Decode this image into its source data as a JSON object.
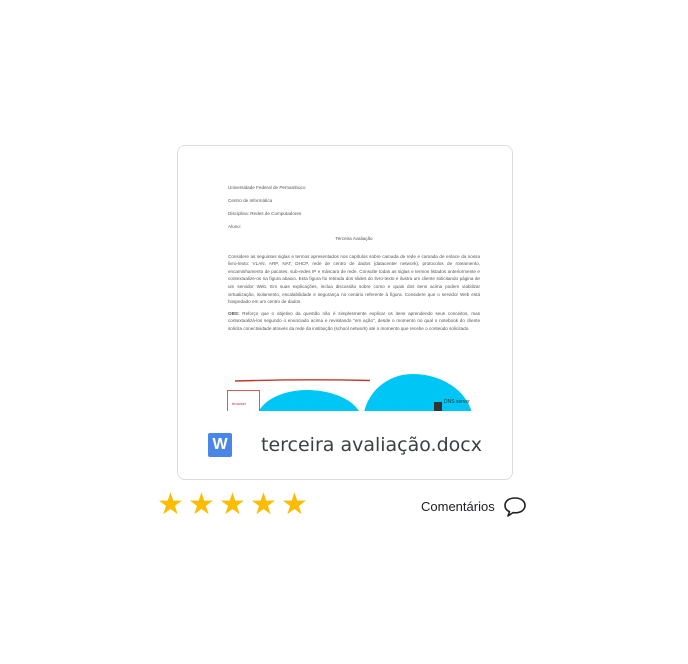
{
  "file": {
    "name": "terceira avaliação.docx",
    "type_icon_letter": "W",
    "type_icon": "word-document-icon"
  },
  "preview": {
    "header_lines": [
      "Universidade Federal de Pernambuco",
      "Centro de Informática",
      "Disciplina: Redes de Computadores",
      "Aluno:"
    ],
    "title": "Terceira Avaliação",
    "paragraph1": "Considere as seguintes siglas e termos apresentados nos capítulos sobre camada de rede e camada de enlace da nossa livro-texto: VLAN, ARP, NAT, DHCP, rede de centro de dados (datacenter network), protocolos de roteamento, encaminhamento de pacotes, sub-redes IP e máscara de rede. Consulte todas as siglas e termos listados anteriormente e contextualize-os na figura abaixo. Esta figura foi retirada dos slides do livro-texto e ilustra um cliente solicitando página de um servidor Web. Em suas explicações, inclua discussão sobre como e quais dos itens acima podem viabilizar virtualização, isolamento, escalabilidade e segurança no cenário referente à figura. Considere que o servidor Web está hospedado em um centro de dados.",
    "note_label": "OBS:",
    "note_text": "Reforço que o objetivo da questão não é simplesmente explicar os itens aprendendo seus conceitos, mas contextualizá-los segundo o enunciado acima e revisitando \"em ação\", desde o momento no qual o notebook do cliente solicita conectividade através da rede da instituição (school network) até o momento que recebe o conteúdo solicitado.",
    "diagram_box_label": "browser",
    "diagram_server_label": "DNS server"
  },
  "rating": {
    "stars": 5,
    "max": 5,
    "color": "#fbbc04"
  },
  "comments": {
    "label": "Comentários",
    "icon": "speech-bubble-icon"
  },
  "colors": {
    "word_blue": "#4a86e8",
    "cloud_cyan": "#00c6f5"
  }
}
